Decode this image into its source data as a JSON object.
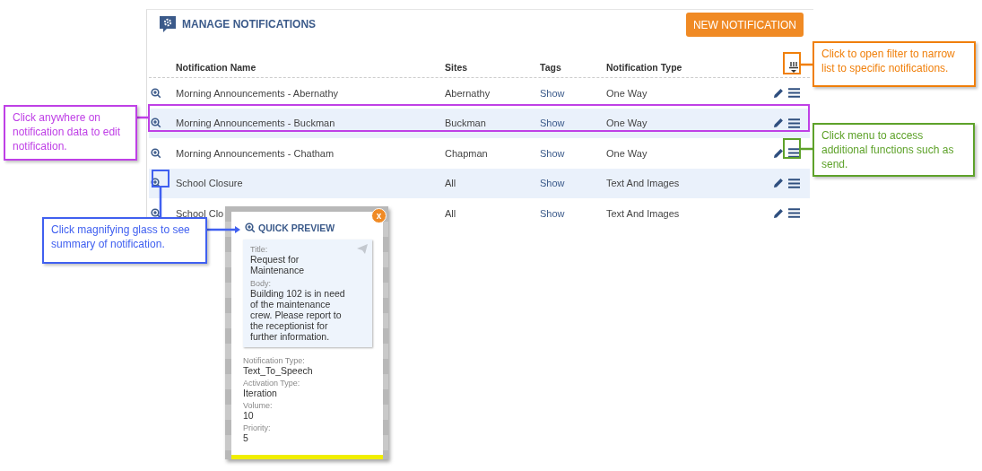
{
  "panel": {
    "title": "MANAGE NOTIFICATIONS",
    "new_button": "NEW NOTIFICATION",
    "columns": [
      "Notification Name",
      "Sites",
      "Tags",
      "Notification Type"
    ],
    "rows": [
      {
        "name": "Morning Announcements - Abernathy",
        "sites": "Abernathy",
        "tags": "Show",
        "type": "One Way"
      },
      {
        "name": "Morning Announcements - Buckman",
        "sites": "Buckman",
        "tags": "Show",
        "type": "One Way"
      },
      {
        "name": "Morning Announcements - Chatham",
        "sites": "Chapman",
        "tags": "Show",
        "type": "One Way"
      },
      {
        "name": "School Closure",
        "sites": "All",
        "tags": "Show",
        "type": "Text And Images"
      },
      {
        "name": "School Clo",
        "sites": "All",
        "tags": "Show",
        "type": "Text And Images"
      }
    ]
  },
  "quick_preview": {
    "title": "QUICK PREVIEW",
    "close": "x",
    "message": [
      {
        "label": "Title:",
        "value": "Request for Maintenance"
      },
      {
        "label": "Body:",
        "value": "Building 102 is in need of the maintenance crew. Please report to the receptionist for further information."
      }
    ],
    "fields": [
      {
        "label": "Notification Type:",
        "value": "Text_To_Speech"
      },
      {
        "label": "Activation Type:",
        "value": "Iteration"
      },
      {
        "label": "Volume:",
        "value": "10"
      },
      {
        "label": "Priority:",
        "value": "5"
      }
    ]
  },
  "callouts": [
    {
      "text": "Click to open filter to narrow list to specific notifications.",
      "color": "#f07f0a"
    },
    {
      "text": "Click anywhere on notification data to edit notification.",
      "color": "#bf40e6"
    },
    {
      "text": "Click menu to access additional functions such as send.",
      "color": "#5ea22a"
    },
    {
      "text": "Click magnifying glass to see summary of notification.",
      "color": "#4060f0"
    }
  ]
}
